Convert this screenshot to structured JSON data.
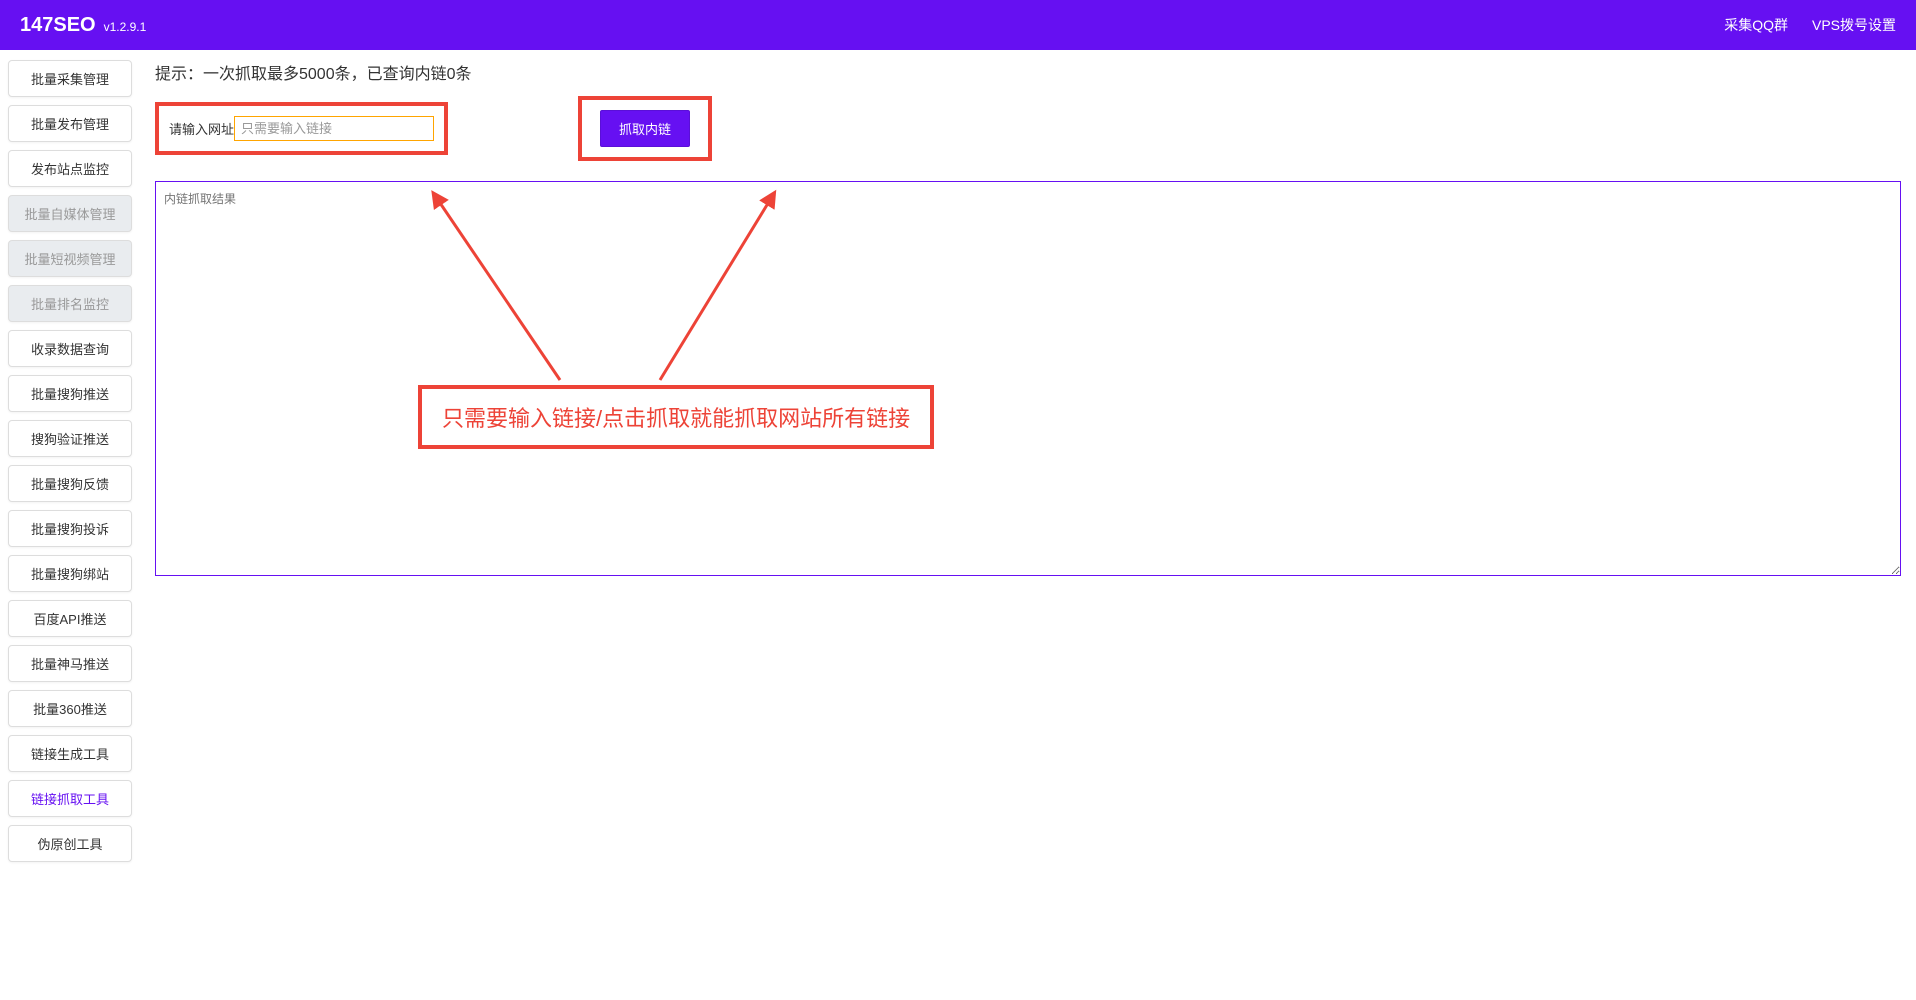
{
  "header": {
    "title": "147SEO",
    "version": "v1.2.9.1",
    "links": {
      "qq_group": "采集QQ群",
      "vps_settings": "VPS拨号设置"
    }
  },
  "sidebar": {
    "items": [
      {
        "label": "批量采集管理",
        "disabled": false,
        "active": false
      },
      {
        "label": "批量发布管理",
        "disabled": false,
        "active": false
      },
      {
        "label": "发布站点监控",
        "disabled": false,
        "active": false
      },
      {
        "label": "批量自媒体管理",
        "disabled": true,
        "active": false
      },
      {
        "label": "批量短视频管理",
        "disabled": true,
        "active": false
      },
      {
        "label": "批量排名监控",
        "disabled": true,
        "active": false
      },
      {
        "label": "收录数据查询",
        "disabled": false,
        "active": false
      },
      {
        "label": "批量搜狗推送",
        "disabled": false,
        "active": false
      },
      {
        "label": "搜狗验证推送",
        "disabled": false,
        "active": false
      },
      {
        "label": "批量搜狗反馈",
        "disabled": false,
        "active": false
      },
      {
        "label": "批量搜狗投诉",
        "disabled": false,
        "active": false
      },
      {
        "label": "批量搜狗绑站",
        "disabled": false,
        "active": false
      },
      {
        "label": "百度API推送",
        "disabled": false,
        "active": false
      },
      {
        "label": "批量神马推送",
        "disabled": false,
        "active": false
      },
      {
        "label": "批量360推送",
        "disabled": false,
        "active": false
      },
      {
        "label": "链接生成工具",
        "disabled": false,
        "active": false
      },
      {
        "label": "链接抓取工具",
        "disabled": false,
        "active": true
      },
      {
        "label": "伪原创工具",
        "disabled": false,
        "active": false
      }
    ]
  },
  "main": {
    "hint": "提示：一次抓取最多5000条，已查询内链0条",
    "input_label": "请输入网址",
    "input_placeholder": "只需要输入链接",
    "crawl_button": "抓取内链",
    "result_placeholder": "内链抓取结果",
    "annotation_text": "只需要输入链接/点击抓取就能抓取网站所有链接"
  },
  "colors": {
    "primary": "#6610f2",
    "annotation": "#ed4337",
    "input_border": "#ffa500"
  }
}
